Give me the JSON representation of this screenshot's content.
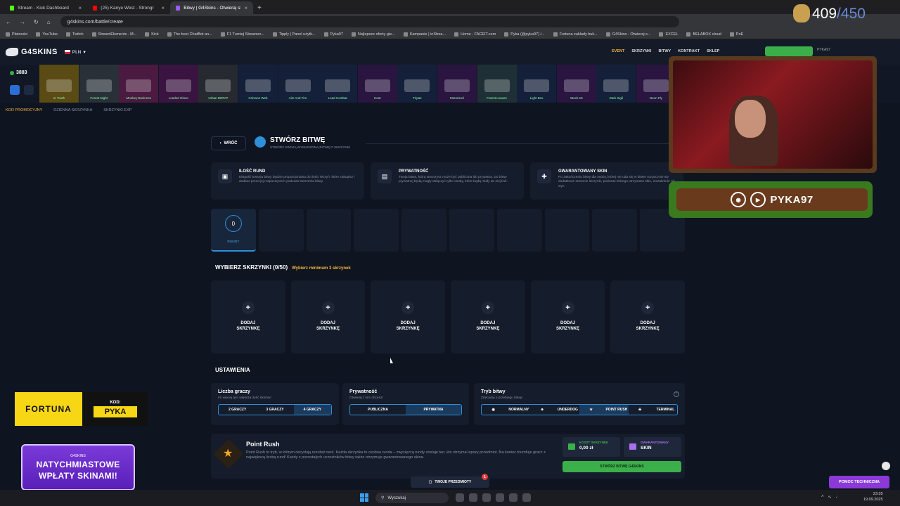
{
  "browser": {
    "tabs": [
      {
        "title": "Stream - Kick Dashboard",
        "color": "#53fc18"
      },
      {
        "title": "(25) Kanye West - Strongr",
        "color": "#ff0000"
      },
      {
        "title": "Bitwy | G4Skins - Otwieraj skrz",
        "color": "#9b5cf5"
      }
    ],
    "new_tab": "+",
    "url": "g4skins.com/battle/create",
    "bookmarks": [
      "Płatności",
      "YouTube",
      "Twitch",
      "StreamElements - M...",
      "Kick",
      "The best ChatBot an...",
      "F1 Turniej Streamer...",
      "Tipply | Panel użytk...",
      "Pyka97",
      "Najlepsze oferty gie...",
      "Kampanie | inStrea...",
      "Home - FACEIT.com",
      "Pyka (@pyka97) /...",
      "Fortuna zakłady buk...",
      "G4Skins - Otwieraj s...",
      "EXCEL",
      "BELABOX cloud",
      "PoE"
    ]
  },
  "header": {
    "logo": "G4SKINS",
    "currency": "PLN",
    "nav": [
      "EVENT",
      "SKRZYNKI",
      "BITWY",
      "KONTRAKT",
      "SKLEP"
    ],
    "user": "PYKA97"
  },
  "strip": {
    "balance": "3883",
    "cases": [
      {
        "name": "er Tooth",
        "color": "#5a4a14"
      },
      {
        "name": "Forest Night",
        "color": "#2a3038"
      },
      {
        "name": "Monkey Business",
        "color": "#4a1a40"
      },
      {
        "name": "Loaded Glove",
        "color": "#3a1440"
      },
      {
        "name": "Urban DDPAT",
        "color": "#262a30"
      },
      {
        "name": "Crimson Web",
        "color": "#14203a"
      },
      {
        "name": "Aim And Fire",
        "color": "#14203a"
      },
      {
        "name": "Lead Combat",
        "color": "#14203a"
      },
      {
        "name": "Heat",
        "color": "#2a1440"
      },
      {
        "name": "Tripas",
        "color": "#14203a"
      },
      {
        "name": "Motorized",
        "color": "#2a1440"
      },
      {
        "name": "Forest Leaves",
        "color": "#1e3036"
      },
      {
        "name": "Light Box",
        "color": "#14203a"
      },
      {
        "name": "Stock-18",
        "color": "#2a1440"
      },
      {
        "name": "Dark Sigil",
        "color": "#14203a"
      },
      {
        "name": "Neon Fly",
        "color": "#2a1440"
      },
      {
        "name": "Sport",
        "color": "#2a1440"
      }
    ]
  },
  "subnav": [
    "KOD PROMOCYJNY",
    "DZIENNA SKRZYNKA",
    "SKRZYNKI EXP"
  ],
  "page": {
    "back": "WRÓĆ",
    "title": "STWÓRZ BITWĘ",
    "subtitle": "STWÓRZ SWOJĄ WYMARZONĄ BITWĘ O SKRZYNKI"
  },
  "info_cards": [
    {
      "title": "ILOŚĆ RUND",
      "text": "Długość trwania bitwy będzie proporcjonalna do ilości skrzyń, które zakupisz i dodasz przed jej rozpoczęciem podczas tworzenia bitwy.",
      "icon": "box"
    },
    {
      "title": "PRYWATNOŚĆ",
      "text": "Twoja bitwa, którą stworzysz może być publiczna lub prywatna. Do bitwy prywatnej będą mogły dołączyć tylko osoby, które będą miały do niej link.",
      "icon": "doc"
    },
    {
      "title": "GWARANTOWANY SKIN",
      "text": "Po zakończeniu bitwy dla osoby, której nie uda się w bitwie rozpocznie się dodatkowe otwarcie skrzynki, podczas którego otrzymasz skin, niezależnie od wyn",
      "icon": "gift"
    }
  ],
  "rounds": {
    "count": "0",
    "label": "RUNDY"
  },
  "select_cases": {
    "title": "WYBIERZ SKRZYNKI (0/50)",
    "hint": "Wybierz minimum 3 skrzynek",
    "add_label": "DODAJ SKRZYNKĘ",
    "slots": 6
  },
  "settings": {
    "title": "USTAWIENIA",
    "players": {
      "title": "Liczba graczy",
      "sub": "Im więcej tym większa ilość skinów!",
      "options": [
        "2 GRACZY",
        "3 GRACZY",
        "4 GRACZY"
      ],
      "selected": 2
    },
    "privacy": {
      "title": "Prywatność",
      "sub": "Otwieraj z kim chcesz!",
      "options": [
        "PUBLICZNA",
        "PRYWATNA"
      ],
      "selected": 1
    },
    "mode": {
      "title": "Tryb bitwy",
      "sub": "Zdecyduj o przebiegu bitwy!",
      "options": [
        "NORMALNY",
        "UNDERDOG",
        "POINT RUSH",
        "TERMINAL"
      ],
      "selected": 2
    }
  },
  "point_rush": {
    "title": "Point Rush",
    "text": "Point Rush to tryb, w którym decydują rezultat rund. Każda skrzynka to osobna runda – zwycięzcą rundy zostaje ten, kto otrzyma lepszy przedmiot. Na koniec triumfuje gracz z największą liczbą rund! Każdy z pozostałych uczestników bitwy także otrzymuje gwarantowanego skina.",
    "cost_label": "KOSZT SKRZYNEK",
    "cost_value": "0,00 zł",
    "guarantee_label": "GWARANTOWANY",
    "guarantee_value": "SKIN",
    "create": "STWÓRZ BITWĘ G4SKINS"
  },
  "bottom": {
    "items": "TWOJE PRZEDMIOTY",
    "items_count": "1",
    "support": "POMOC TECHNICZNA"
  },
  "overlay": {
    "counter_current": "409",
    "counter_sep": "/",
    "counter_max": "450",
    "streamer": "PYKA97",
    "fortuna_brand": "FORTUNA",
    "fortuna_kod": "KOD:",
    "fortuna_code": "PYKA",
    "promo_brand": "G4SKINS",
    "promo_line1": "NATYCHMIASTOWE",
    "promo_line2": "WPŁATY SKINAMI!"
  },
  "taskbar": {
    "search": "Wyszukaj",
    "time": "23:35",
    "date": "19.09.2025"
  }
}
